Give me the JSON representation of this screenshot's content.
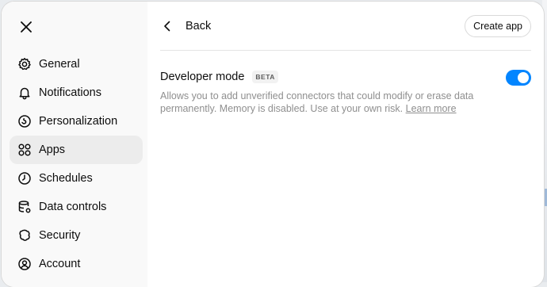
{
  "sidebar": {
    "close_icon": "close-icon",
    "items": [
      {
        "label": "General",
        "icon": "gear-icon",
        "active": false
      },
      {
        "label": "Notifications",
        "icon": "bell-icon",
        "active": false
      },
      {
        "label": "Personalization",
        "icon": "personalization-icon",
        "active": false
      },
      {
        "label": "Apps",
        "icon": "grid-icon",
        "active": true
      },
      {
        "label": "Schedules",
        "icon": "clock-icon",
        "active": false
      },
      {
        "label": "Data controls",
        "icon": "database-icon",
        "active": false
      },
      {
        "label": "Security",
        "icon": "shield-icon",
        "active": false
      },
      {
        "label": "Account",
        "icon": "account-icon",
        "active": false
      }
    ]
  },
  "header": {
    "back_label": "Back",
    "create_label": "Create app"
  },
  "setting": {
    "title": "Developer mode",
    "badge": "BETA",
    "description": "Allows you to add unverified connectors that could modify or erase data permanently. Memory is disabled. Use at your own risk.",
    "link": "Learn more",
    "enabled": true
  },
  "colors": {
    "accent": "#0285ff",
    "sidebar_bg": "#f9f9f9",
    "active_item_bg": "#ececec"
  }
}
